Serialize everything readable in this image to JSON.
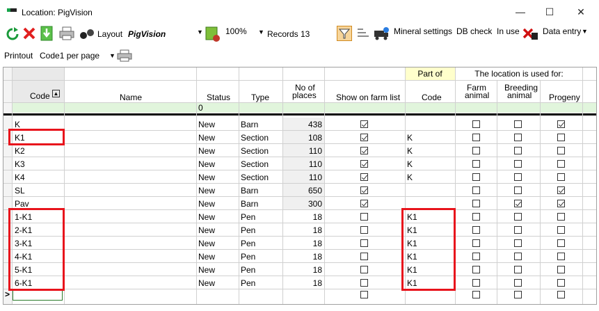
{
  "window": {
    "title": "Location: PigVision",
    "minimize": "—",
    "maximize": "☐",
    "close": "✕"
  },
  "toolbar": {
    "layout_label": "Layout",
    "layout_value": "PigVision",
    "zoom": "100%",
    "records_label": "Records",
    "records_count": "13",
    "mineral_settings": "Mineral settings",
    "db_check": "DB check",
    "in_use": "In use",
    "data_entry": "Data entry"
  },
  "printout": {
    "label": "Printout",
    "value": "Code1 per page"
  },
  "grid": {
    "group_headers": {
      "part_of": "Part of",
      "used_for": "The location is used for:"
    },
    "headers": {
      "code": "Code",
      "name": "Name",
      "status": "Status",
      "type": "Type",
      "no_places_1": "No of",
      "no_places_2": "places",
      "show_farm": "Show on farm list",
      "part_code": "Code",
      "farm_1": "Farm",
      "farm_2": "animal",
      "breeding_1": "Breeding",
      "breeding_2": "animal",
      "progeny": "Progeny"
    },
    "filter_status": "0",
    "new_row_marker": ">",
    "rows": [
      {
        "code": "K",
        "name": "",
        "status": "New",
        "type": "Barn",
        "places": "438",
        "show": true,
        "part": "",
        "farm": false,
        "breeding": false,
        "progeny": true
      },
      {
        "code": "K1",
        "name": "",
        "status": "New",
        "type": "Section",
        "places": "108",
        "show": true,
        "part": "K",
        "farm": false,
        "breeding": false,
        "progeny": false
      },
      {
        "code": "K2",
        "name": "",
        "status": "New",
        "type": "Section",
        "places": "110",
        "show": true,
        "part": "K",
        "farm": false,
        "breeding": false,
        "progeny": false
      },
      {
        "code": "K3",
        "name": "",
        "status": "New",
        "type": "Section",
        "places": "110",
        "show": true,
        "part": "K",
        "farm": false,
        "breeding": false,
        "progeny": false
      },
      {
        "code": "K4",
        "name": "",
        "status": "New",
        "type": "Section",
        "places": "110",
        "show": true,
        "part": "K",
        "farm": false,
        "breeding": false,
        "progeny": false
      },
      {
        "code": "SL",
        "name": "",
        "status": "New",
        "type": "Barn",
        "places": "650",
        "show": true,
        "part": "",
        "farm": false,
        "breeding": false,
        "progeny": true
      },
      {
        "code": "Pav",
        "name": "",
        "status": "New",
        "type": "Barn",
        "places": "300",
        "show": true,
        "part": "",
        "farm": false,
        "breeding": true,
        "progeny": true
      },
      {
        "code": "1-K1",
        "name": "",
        "status": "New",
        "type": "Pen",
        "places": "18",
        "show": false,
        "part": "K1",
        "farm": false,
        "breeding": false,
        "progeny": false
      },
      {
        "code": "2-K1",
        "name": "",
        "status": "New",
        "type": "Pen",
        "places": "18",
        "show": false,
        "part": "K1",
        "farm": false,
        "breeding": false,
        "progeny": false
      },
      {
        "code": "3-K1",
        "name": "",
        "status": "New",
        "type": "Pen",
        "places": "18",
        "show": false,
        "part": "K1",
        "farm": false,
        "breeding": false,
        "progeny": false
      },
      {
        "code": "4-K1",
        "name": "",
        "status": "New",
        "type": "Pen",
        "places": "18",
        "show": false,
        "part": "K1",
        "farm": false,
        "breeding": false,
        "progeny": false
      },
      {
        "code": "5-K1",
        "name": "",
        "status": "New",
        "type": "Pen",
        "places": "18",
        "show": false,
        "part": "K1",
        "farm": false,
        "breeding": false,
        "progeny": false
      },
      {
        "code": "6-K1",
        "name": "",
        "status": "New",
        "type": "Pen",
        "places": "18",
        "show": false,
        "part": "K1",
        "farm": false,
        "breeding": false,
        "progeny": false
      }
    ]
  },
  "colors": {
    "highlight_red": "#e8141c",
    "part_of_header_bg": "#ffffcc",
    "filter_row_bg": "#e1f5dc",
    "separator": "#000000"
  }
}
